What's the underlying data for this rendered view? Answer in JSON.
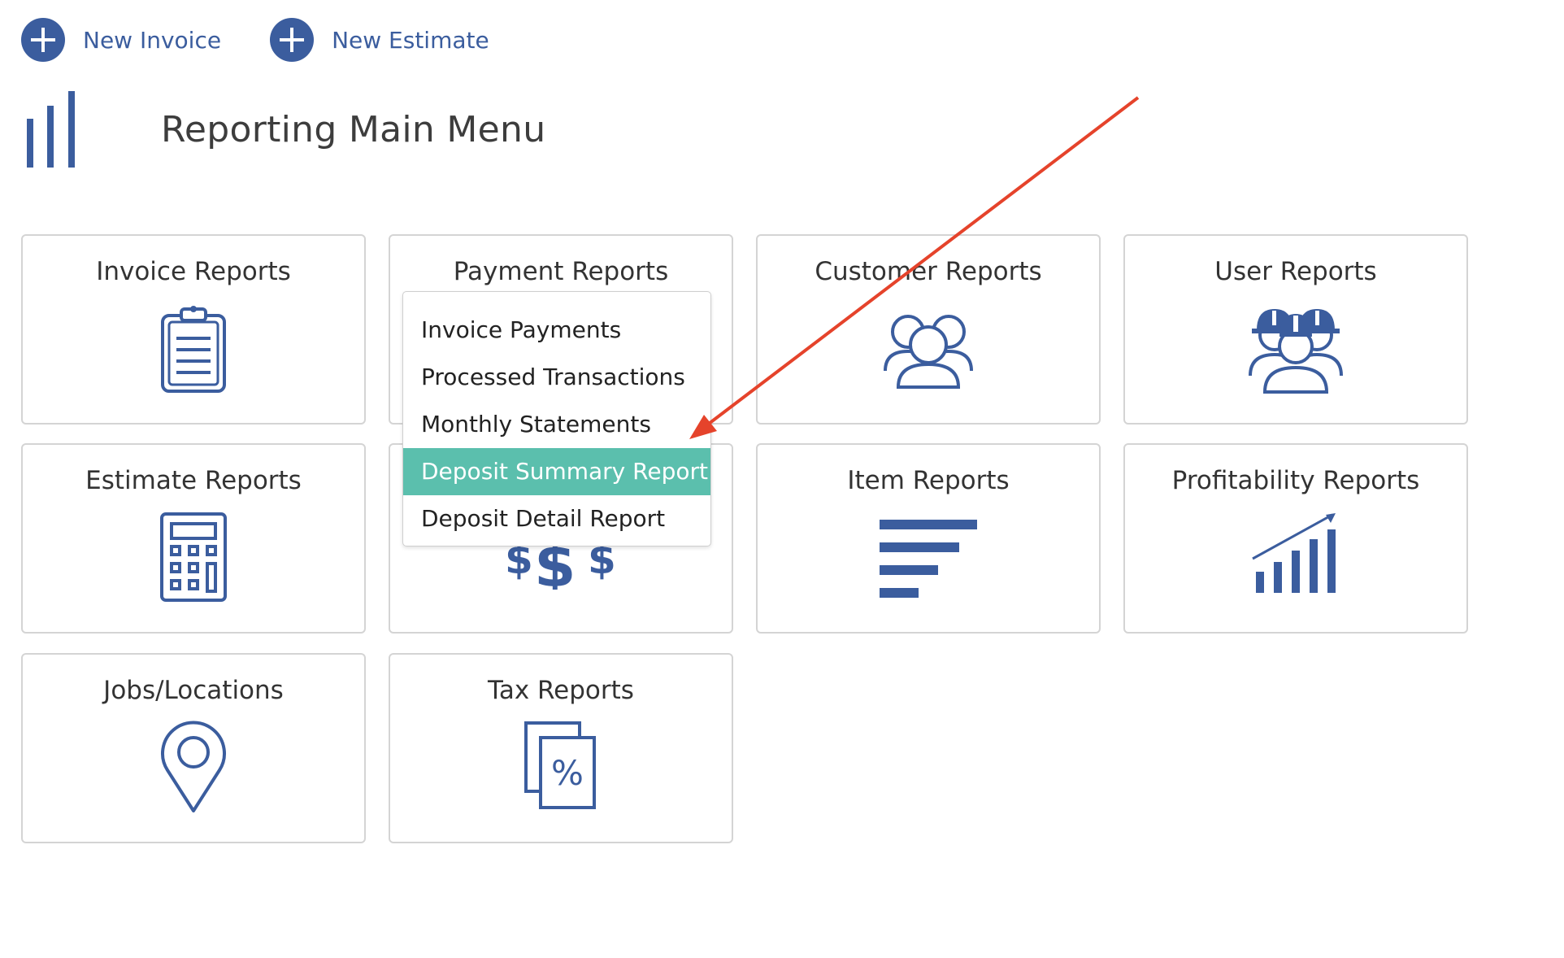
{
  "colors": {
    "brand_blue": "#3b5d9e",
    "active_teal": "#5bbfad",
    "annotation_red": "#e5432b",
    "card_border": "#d4d4d4"
  },
  "topbar": {
    "new_invoice": {
      "label": "New Invoice",
      "icon": "plus-circle-icon"
    },
    "new_estimate": {
      "label": "New Estimate",
      "icon": "plus-circle-icon"
    }
  },
  "header": {
    "title": "Reporting Main Menu",
    "icon": "bar-chart-icon"
  },
  "cards": {
    "invoice": {
      "title": "Invoice Reports",
      "icon": "clipboard-icon"
    },
    "payment": {
      "title": "Payment Reports",
      "icon": "dollar-signs-icon"
    },
    "customer": {
      "title": "Customer Reports",
      "icon": "people-group-icon"
    },
    "user": {
      "title": "User Reports",
      "icon": "workers-hardhat-icon"
    },
    "estimate": {
      "title": "Estimate Reports",
      "icon": "calculator-icon"
    },
    "item": {
      "title": "Item Reports",
      "icon": "sort-lines-icon"
    },
    "profitability": {
      "title": "Profitability Reports",
      "icon": "growth-chart-icon"
    },
    "jobs": {
      "title": "Jobs/Locations",
      "icon": "map-pin-icon"
    },
    "tax": {
      "title": "Tax Reports",
      "icon": "percent-document-icon"
    }
  },
  "payment_dropdown": {
    "items": [
      {
        "label": "Invoice Payments"
      },
      {
        "label": "Processed Transactions"
      },
      {
        "label": "Monthly Statements"
      },
      {
        "label": "Deposit Summary Report",
        "active": true
      },
      {
        "label": "Deposit Detail Report"
      }
    ]
  },
  "annotation": {
    "type": "arrow",
    "target": "Deposit Summary Report"
  }
}
